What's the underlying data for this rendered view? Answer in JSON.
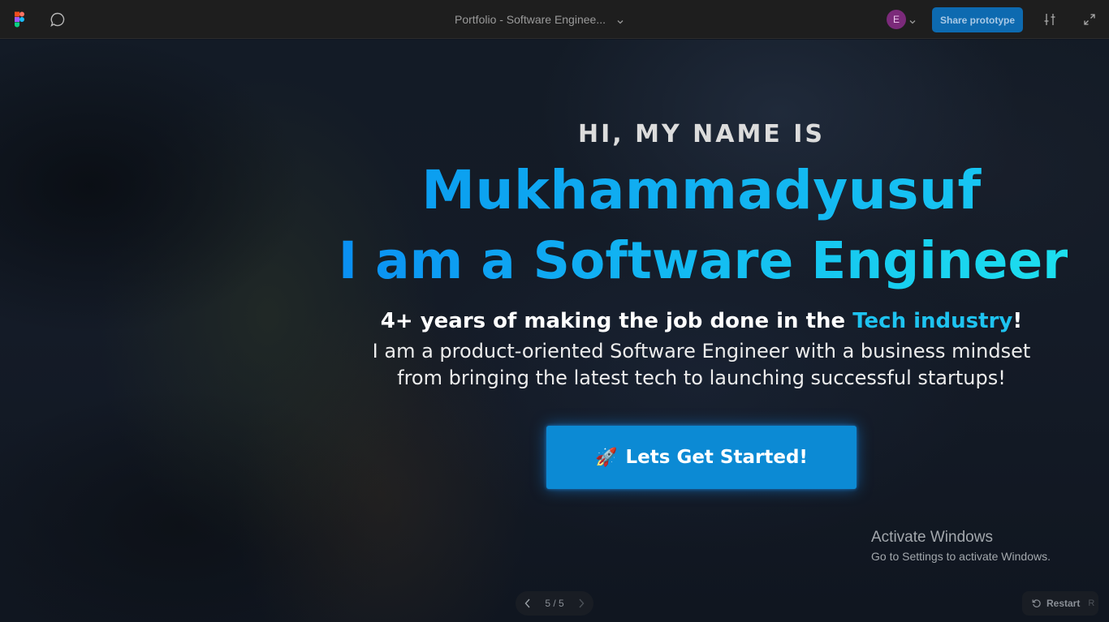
{
  "toolbar": {
    "file_title": "Portfolio - Software Enginee...",
    "avatar_initial": "E",
    "share_label": "Share prototype",
    "icons": [
      "figma-logo-icon",
      "comment-icon",
      "chevron-down-icon",
      "settings-sliders-icon",
      "expand-icon"
    ]
  },
  "hero": {
    "kicker": "HI, MY NAME IS",
    "name": "Mukhammadyusuf",
    "role": "I am a Software Engineer",
    "subtitle_start": "4+ years of making the job done in the ",
    "subtitle_accent": "Tech industry",
    "subtitle_end": "!",
    "desc_line1": "I am a product-oriented Software Engineer with a business mindset",
    "desc_line2": "from bringing the latest tech to launching successful startups!",
    "cta_emoji": "🚀",
    "cta_label": "Lets Get Started!"
  },
  "watermark": {
    "title": "Activate Windows",
    "subtitle": "Go to Settings to activate Windows."
  },
  "pager": {
    "count": "5 / 5"
  },
  "restart": {
    "label": "Restart",
    "shortcut": "R"
  },
  "colors": {
    "accent_blue": "#1ea8f3",
    "accent_cyan": "#1de0ee",
    "cta_bg": "#0c8ad4",
    "share_bg": "#0d6ab0",
    "toolbar_bg": "#1e1e1e"
  }
}
